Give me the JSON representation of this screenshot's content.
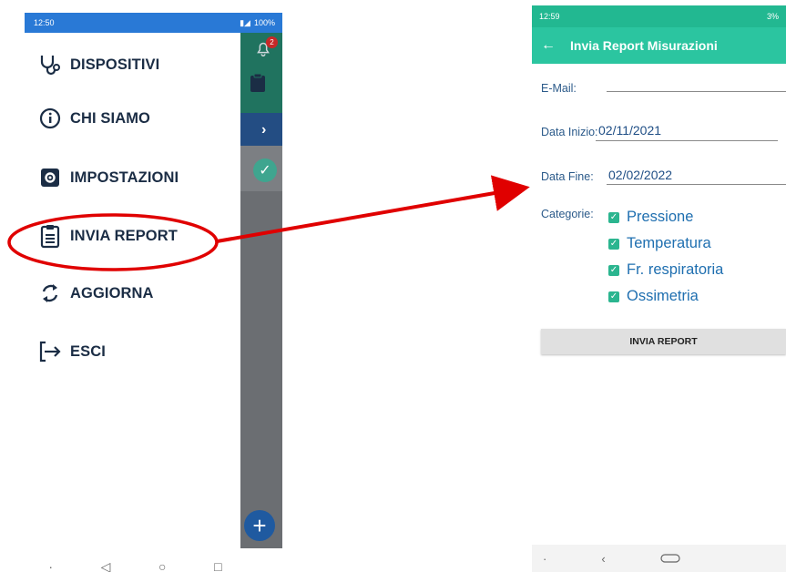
{
  "left_screen": {
    "status": {
      "time": "12:50",
      "battery": "100%"
    },
    "background_app": {
      "notification_count": "2"
    },
    "menu": [
      {
        "label": "DISPOSITIVI",
        "icon": "stethoscope-icon"
      },
      {
        "label": "CHI SIAMO",
        "icon": "info-icon"
      },
      {
        "label": "IMPOSTAZIONI",
        "icon": "settings-icon"
      },
      {
        "label": "INVIA REPORT",
        "icon": "clipboard-icon"
      },
      {
        "label": "AGGIORNA",
        "icon": "refresh-icon"
      },
      {
        "label": "ESCI",
        "icon": "exit-icon"
      }
    ]
  },
  "right_screen": {
    "status": {
      "time": "12:59",
      "battery": "3%"
    },
    "appbar": {
      "title": "Invia Report Misurazioni"
    },
    "form": {
      "email_label": "E-Mail:",
      "email_value": "",
      "start_label": "Data Inizio:",
      "start_value": "02/11/2021",
      "end_label": "Data Fine:",
      "end_value": "02/02/2022",
      "categories_label": "Categorie:",
      "categories": [
        {
          "label": "Pressione",
          "checked": true
        },
        {
          "label": "Temperatura",
          "checked": true
        },
        {
          "label": "Fr. respiratoria",
          "checked": true
        },
        {
          "label": "Ossimetria",
          "checked": true
        }
      ],
      "send_label": "INVIA REPORT"
    }
  },
  "colors": {
    "drawer_text": "#1b2d45",
    "accent_teal": "#2bc5a0",
    "annotation_red": "#e00000"
  }
}
